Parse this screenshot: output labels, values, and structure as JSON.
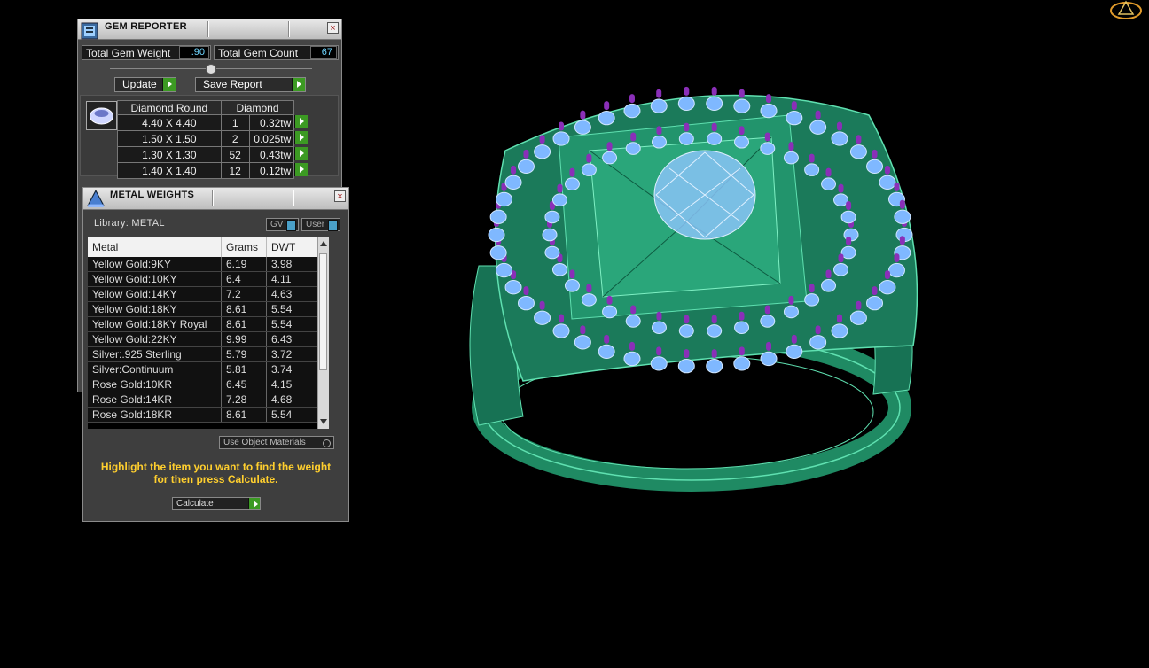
{
  "gem_reporter": {
    "title": "GEM REPORTER",
    "close": "×",
    "total_gem_weight_label": "Total Gem Weight",
    "total_gem_weight_value": ".90",
    "total_gem_count_label": "Total Gem Count",
    "total_gem_count_value": "67",
    "update_label": "Update",
    "save_report_label": "Save Report",
    "table_headers": [
      "Diamond Round",
      "Diamond"
    ],
    "rows": [
      {
        "size": "4.40 X 4.40",
        "count": "1",
        "weight": "0.32tw"
      },
      {
        "size": "1.50 X 1.50",
        "count": "2",
        "weight": "0.025tw"
      },
      {
        "size": "1.30 X 1.30",
        "count": "52",
        "weight": "0.43tw"
      },
      {
        "size": "1.40 X 1.40",
        "count": "12",
        "weight": "0.12tw"
      }
    ]
  },
  "metal_weights": {
    "title": "METAL WEIGHTS",
    "close": "×",
    "library_label": "Library: METAL",
    "gv_label": "GV",
    "user_label": "User",
    "headers": [
      "Metal",
      "Grams",
      "DWT"
    ],
    "rows": [
      {
        "metal": "Yellow Gold:9KY",
        "grams": "6.19",
        "dwt": "3.98"
      },
      {
        "metal": "Yellow Gold:10KY",
        "grams": "6.4",
        "dwt": "4.11"
      },
      {
        "metal": "Yellow Gold:14KY",
        "grams": "7.2",
        "dwt": "4.63"
      },
      {
        "metal": "Yellow Gold:18KY",
        "grams": "8.61",
        "dwt": "5.54"
      },
      {
        "metal": "Yellow Gold:18KY Royal",
        "grams": "8.61",
        "dwt": "5.54"
      },
      {
        "metal": "Yellow Gold:22KY",
        "grams": "9.99",
        "dwt": "6.43"
      },
      {
        "metal": "Silver:.925 Sterling",
        "grams": "5.79",
        "dwt": "3.72"
      },
      {
        "metal": "Silver:Continuum",
        "grams": "5.81",
        "dwt": "3.74"
      },
      {
        "metal": "Rose Gold:10KR",
        "grams": "6.45",
        "dwt": "4.15"
      },
      {
        "metal": "Rose Gold:14KR",
        "grams": "7.28",
        "dwt": "4.68"
      },
      {
        "metal": "Rose Gold:18KR",
        "grams": "8.61",
        "dwt": "5.54"
      }
    ],
    "use_object_materials_label": "Use Object Materials",
    "hint": "Highlight the item you want to find the weight for then press Calculate.",
    "calculate_label": "Calculate"
  },
  "colors": {
    "ring_metal": "#1f8a63",
    "ring_edge": "#5fe0b0",
    "stones": "#7fb8ff",
    "prongs": "#8a2fb8",
    "hint_text": "#ffcf2e"
  }
}
